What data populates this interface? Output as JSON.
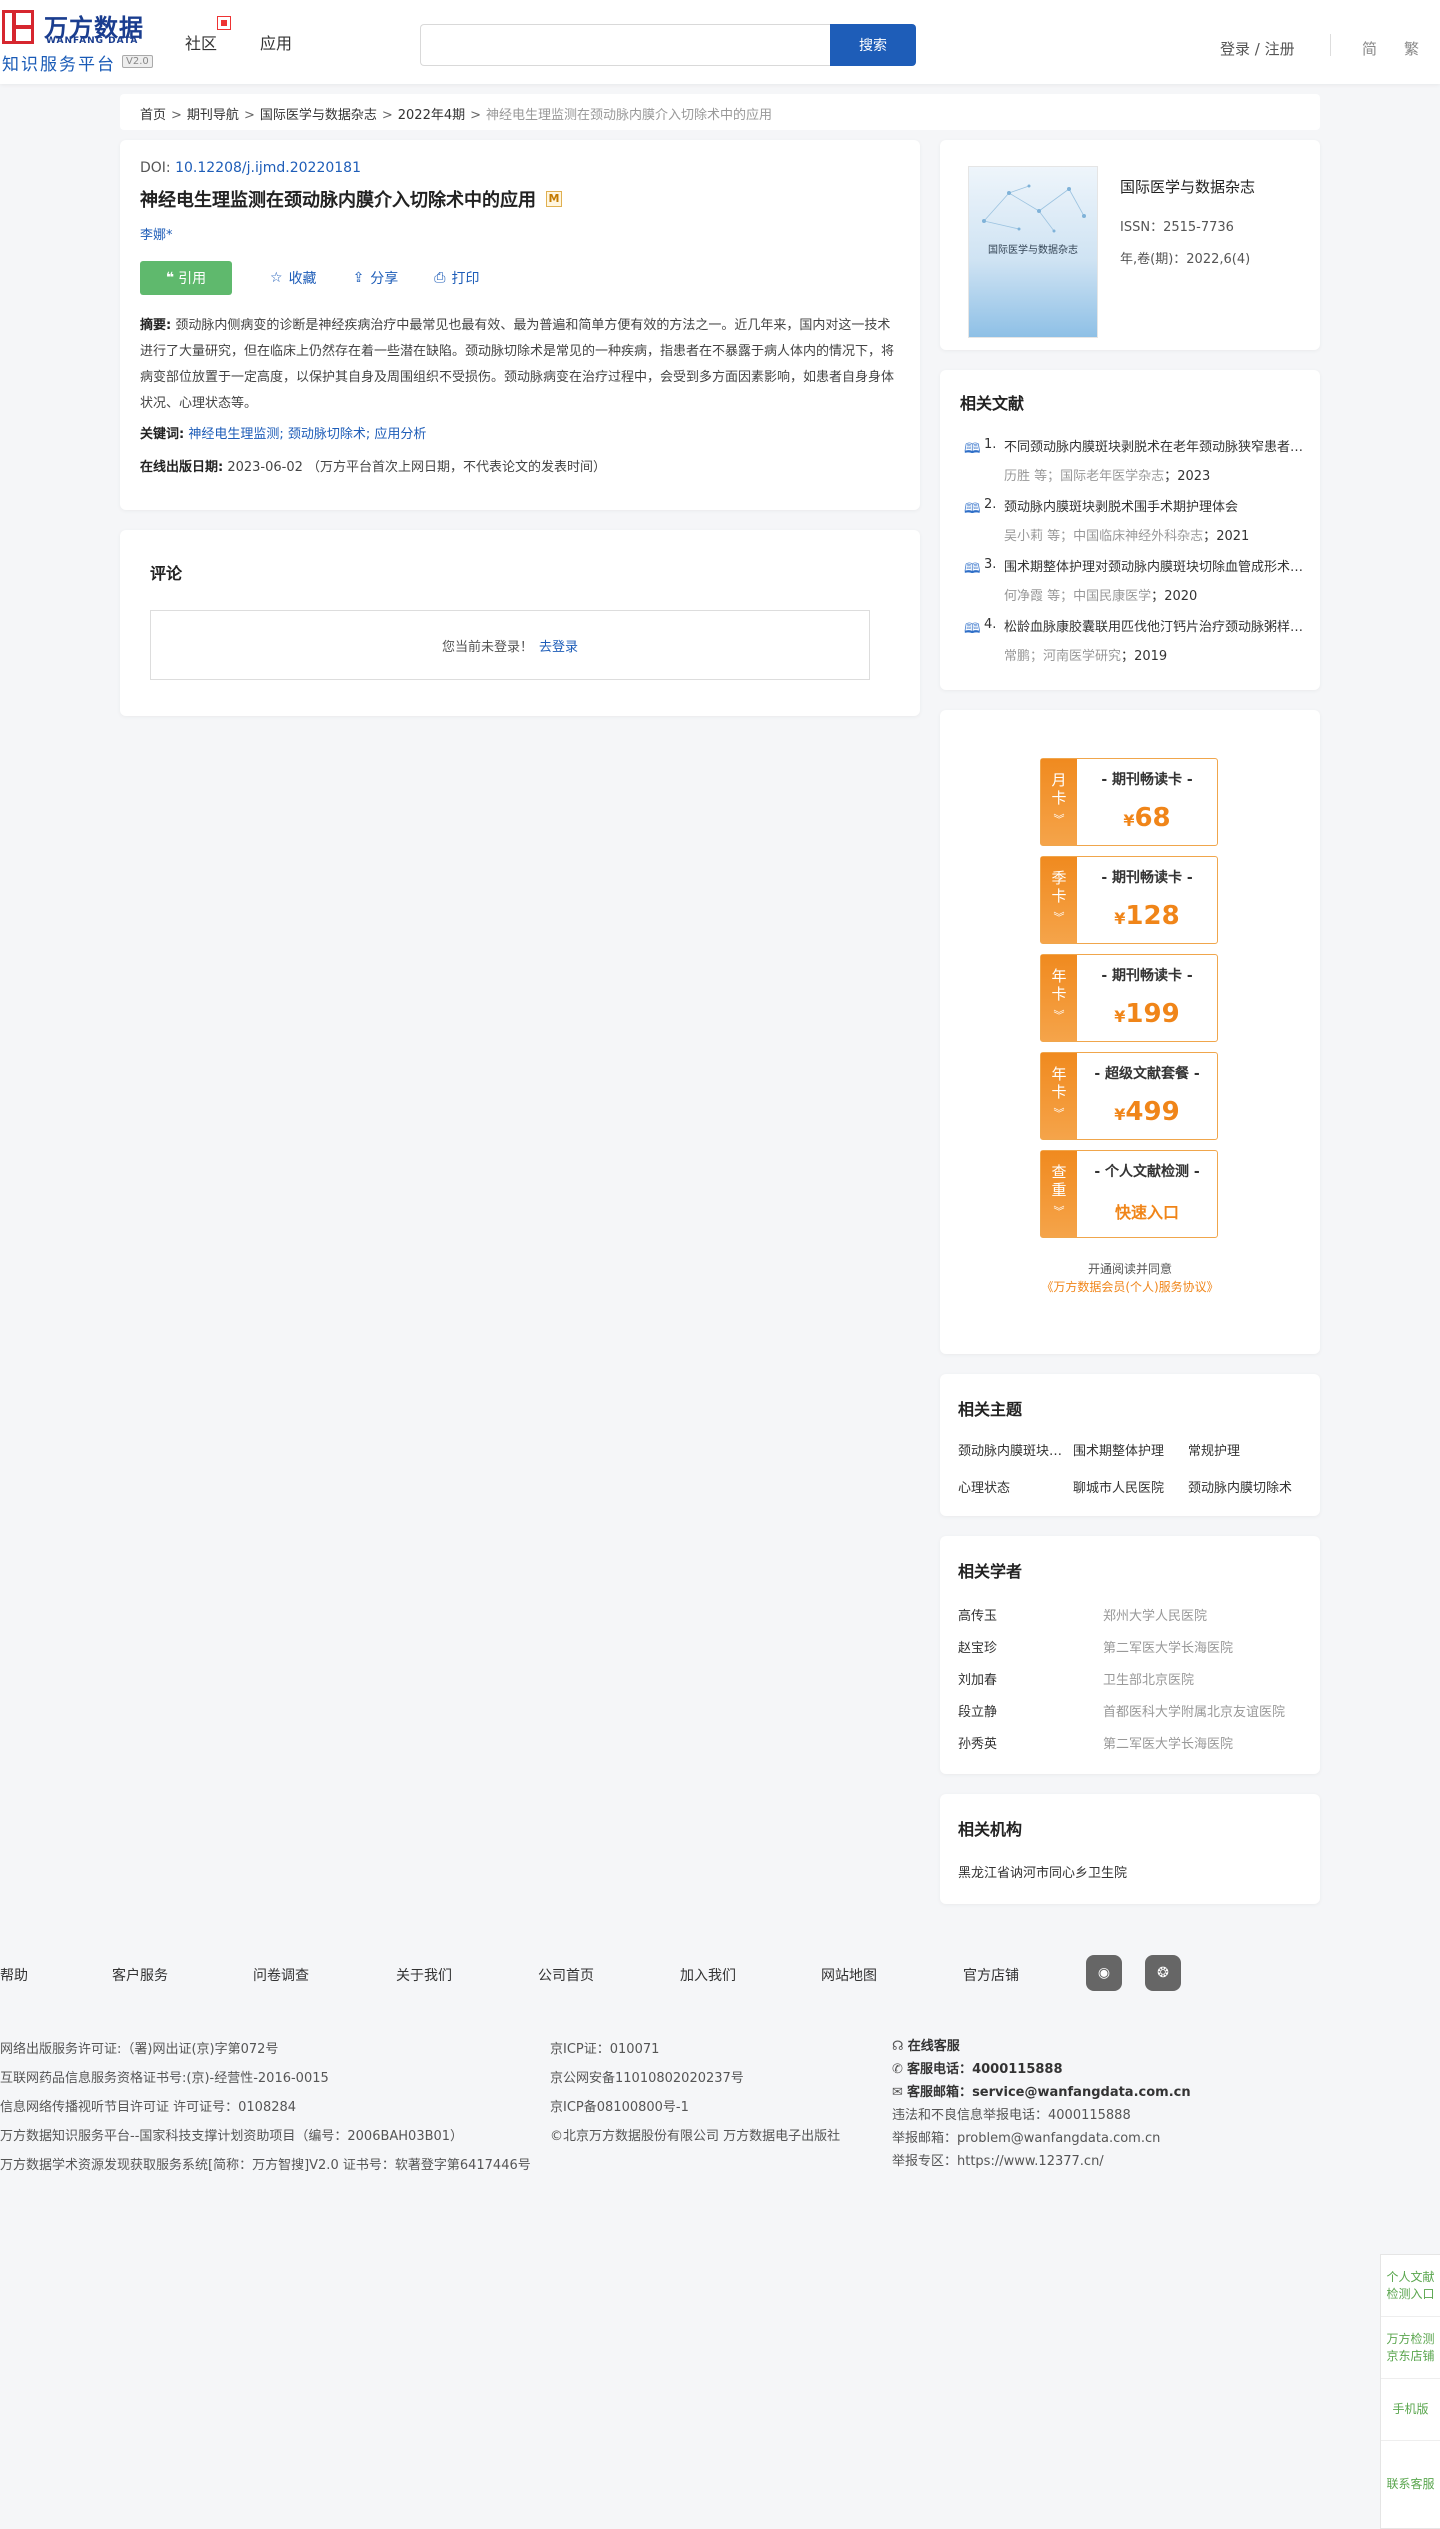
{
  "header": {
    "logo_cn": "万方数据",
    "logo_en": "WANFANG DATA",
    "logo_sub": "知识服务平台",
    "logo_version": "V2.0",
    "nav": [
      "社区",
      "应用"
    ],
    "search_placeholder": "",
    "search_button": "搜索",
    "login": "登录 / 注册",
    "lang_simplified": "简",
    "lang_traditional": "繁"
  },
  "breadcrumb": {
    "items": [
      "首页",
      "期刊导航",
      "国际医学与数据杂志",
      "2022年4期"
    ],
    "current": "神经电生理监测在颈动脉内膜介入切除术中的应用",
    "separator": ">"
  },
  "article": {
    "doi_label": "DOI:",
    "doi": "10.12208/j.ijmd.20220181",
    "title": "神经电生理监测在颈动脉内膜介入切除术中的应用",
    "title_badge": "M",
    "author": "李娜*",
    "actions": {
      "cite": "引用",
      "favorite": "收藏",
      "share": "分享",
      "print": "打印"
    },
    "abstract_label": "摘要:",
    "abstract": "颈动脉内侧病变的诊断是神经疾病治疗中最常见也最有效、最为普遍和简单方便有效的方法之一。近几年来，国内对这一技术进行了大量研究，但在临床上仍然存在着一些潜在缺陷。颈动脉切除术是常见的一种疾病，指患者在不暴露于病人体内的情况下，将病变部位放置于一定高度，以保护其自身及周围组织不受损伤。颈动脉病变在治疗过程中，会受到多方面因素影响，如患者自身身体状况、心理状态等。",
    "keywords_label": "关键词:",
    "keywords": [
      "神经电生理监测;",
      "颈动脉切除术;",
      "应用分析"
    ],
    "pubdate_label": "在线出版日期:",
    "pubdate": "2023-06-02",
    "pubdate_note": "（万方平台首次上网日期，不代表论文的发表时间）"
  },
  "comments": {
    "title": "评论",
    "not_logged_in": "您当前未登录！",
    "login_link": "去登录"
  },
  "journal": {
    "cover_title": "国际医学与数据杂志",
    "name": "国际医学与数据杂志",
    "issn": "ISSN：2515-7736",
    "year_vol": "年,卷(期)：2022,6(4)"
  },
  "related_docs": {
    "title": "相关文献",
    "items": [
      {
        "num": "1.",
        "title": "不同颈动脉内膜斑块剥脱术在老年颈动脉狭窄患者中的应用",
        "authors": "历胜 等",
        "source": "国际老年医学杂志",
        "year": "2023"
      },
      {
        "num": "2.",
        "title": "颈动脉内膜斑块剥脱术围手术期护理体会",
        "authors": "吴小莉 等",
        "source": "中国临床神经外科杂志",
        "year": "2021"
      },
      {
        "num": "3.",
        "title": "围术期整体护理对颈动脉内膜斑块切除血管成形术患者的影响",
        "authors": "何净霞 等",
        "source": "中国民康医学",
        "year": "2020"
      },
      {
        "num": "4.",
        "title": "松龄血脉康胶囊联用匹伐他汀钙片治疗颈动脉粥样硬化斑块",
        "authors": "常鹏",
        "source": "河南医学研究",
        "year": "2019"
      }
    ]
  },
  "promo": {
    "cards": [
      {
        "tag": [
          "月",
          "卡"
        ],
        "name": "- 期刊畅读卡 -",
        "currency": "¥",
        "price": "68"
      },
      {
        "tag": [
          "季",
          "卡"
        ],
        "name": "- 期刊畅读卡 -",
        "currency": "¥",
        "price": "128"
      },
      {
        "tag": [
          "年",
          "卡"
        ],
        "name": "- 期刊畅读卡 -",
        "currency": "¥",
        "price": "199"
      },
      {
        "tag": [
          "年",
          "卡"
        ],
        "name": "- 超级文献套餐 -",
        "currency": "¥",
        "price": "499"
      },
      {
        "tag": [
          "查",
          "重"
        ],
        "name": "- 个人文献检测 -",
        "link": "快速入口"
      }
    ],
    "note": "开通阅读并同意",
    "agreement": "《万方数据会员(个人)服务协议》"
  },
  "topics": {
    "title": "相关主题",
    "items": [
      "颈动脉内膜斑块剥脱术",
      "围术期整体护理",
      "常规护理",
      "心理状态",
      "聊城市人民医院",
      "颈动脉内膜切除术"
    ]
  },
  "scholars": {
    "title": "相关学者",
    "items": [
      {
        "name": "高传玉",
        "org": "郑州大学人民医院"
      },
      {
        "name": "赵宝珍",
        "org": "第二军医大学长海医院"
      },
      {
        "name": "刘加春",
        "org": "卫生部北京医院"
      },
      {
        "name": "段立静",
        "org": "首都医科大学附属北京友谊医院"
      },
      {
        "name": "孙秀英",
        "org": "第二军医大学长海医院"
      }
    ]
  },
  "institutions": {
    "title": "相关机构",
    "items": [
      "黑龙江省讷河市同心乡卫生院"
    ]
  },
  "footer": {
    "links": [
      "帮助",
      "客户服务",
      "问卷调查",
      "关于我们",
      "公司首页",
      "加入我们",
      "网站地图",
      "官方店铺"
    ],
    "col1": [
      "网络出版服务许可证:（署)网出证(京)字第072号",
      "互联网药品信息服务资格证书号:(京)-经营性-2016-0015",
      "信息网络传播视听节目许可证 许可证号：0108284",
      "万方数据知识服务平台--国家科技支撑计划资助项目（编号：2006BAH03B01）",
      "万方数据学术资源发现获取服务系统[简称：万方智搜]V2.0 证书号：软著登字第6417446号"
    ],
    "col2": [
      "京ICP证：010071",
      "京公网安备11010802020237号",
      "京ICP备08100800号-1",
      "©北京万方数据股份有限公司 万方数据电子出版社"
    ],
    "online_service": "在线客服",
    "phone_label": "客服电话：",
    "phone": "4000115888",
    "email_label": "客服邮箱：",
    "email": "service@wanfangdata.com.cn",
    "report_phone": "违法和不良信息举报电话：4000115888",
    "report_email": "举报邮箱：problem@wanfangdata.com.cn",
    "report_area": "举报专区：https://www.12377.cn/"
  },
  "side_float": [
    "个人文献检测入口",
    "万方检测京东店铺",
    "手机版",
    "联系客服"
  ]
}
